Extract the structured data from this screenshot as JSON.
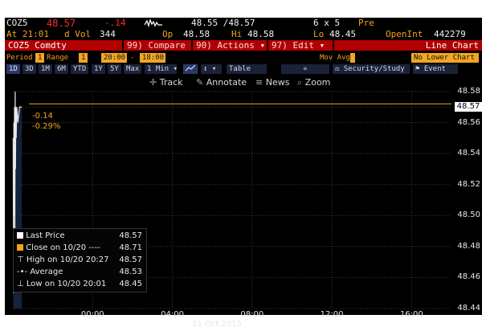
{
  "ticker": {
    "symbol": "COZ5",
    "last": "48.57",
    "change": "-.14",
    "bid_ask": "48.55 /48.57",
    "size": "6 x 5",
    "pre": "Pre",
    "at_time": "At 21:01",
    "vol_label": "d Vol",
    "vol": "344",
    "open_label": "Op",
    "open": "48.58",
    "high_label": "Hi",
    "high": "48.58",
    "low_label": "Lo",
    "low": "48.45",
    "oi_label": "OpenInt",
    "oi": "442279"
  },
  "security_bar": {
    "security": "COZ5 Comdty",
    "compare": "99) Compare",
    "actions": "90) Actions",
    "edit": "97) Edit",
    "chart_type": "Line Chart"
  },
  "period_bar": {
    "period_label": "Period",
    "period_val": "1",
    "range_label": "Range",
    "range_val": "1",
    "from": "20:00",
    "dash": "-",
    "to": "18:00",
    "mov_avg": "Mov Avg",
    "lower_chart": "No Lower Chart"
  },
  "timeframes": [
    "1D",
    "3D",
    "1M",
    "6M",
    "YTD",
    "1Y",
    "5Y",
    "Max",
    "1 Min"
  ],
  "view_buttons": {
    "chart_icon": "line-chart-icon",
    "up_down": "↕",
    "table": "Table",
    "back": "«",
    "security_study": "Security/Study",
    "event": "Event"
  },
  "toolbar": {
    "track": "Track",
    "annotate": "Annotate",
    "news": "News",
    "zoom": "Zoom"
  },
  "chart_data": {
    "type": "line",
    "x": [
      "20:01",
      "20:02",
      "20:03",
      "20:04",
      "20:05",
      "20:06",
      "20:07",
      "20:08",
      "20:09",
      "20:10",
      "20:12",
      "20:15",
      "20:20",
      "20:27"
    ],
    "y": [
      48.55,
      48.45,
      48.56,
      48.5,
      48.57,
      48.48,
      48.58,
      48.53,
      48.57,
      48.55,
      48.57,
      48.56,
      48.57,
      48.57
    ],
    "yaxis_ticks": [
      "48.58",
      "48.57",
      "48.56",
      "48.54",
      "48.52",
      "48.50",
      "48.48",
      "48.46",
      "48.44"
    ],
    "ylim": [
      48.44,
      48.58
    ],
    "xaxis_ticks": [
      "00:00",
      "04:00",
      "08:00",
      "12:00",
      "16:00"
    ],
    "xaxis_date": "21 Oct 2015",
    "close_line": 48.71,
    "last_price": "48.57",
    "annotation_change": "-0.14",
    "annotation_pct": "-0.29%",
    "line_color": "#e8e8e8",
    "accent": "#f7a21b"
  },
  "legend": [
    {
      "label": "Last Price",
      "value": "48.57",
      "icon": "white-square-icon"
    },
    {
      "label": "Close on 10/20 ----",
      "value": "48.71",
      "icon": "orange-square-icon"
    },
    {
      "label": "High on 10/20 20:27",
      "value": "48.57",
      "icon": "high-marker-icon"
    },
    {
      "label": "Average",
      "value": "48.53",
      "icon": "average-line-icon"
    },
    {
      "label": "Low on 10/20 20:01",
      "value": "48.45",
      "icon": "low-marker-icon"
    }
  ]
}
